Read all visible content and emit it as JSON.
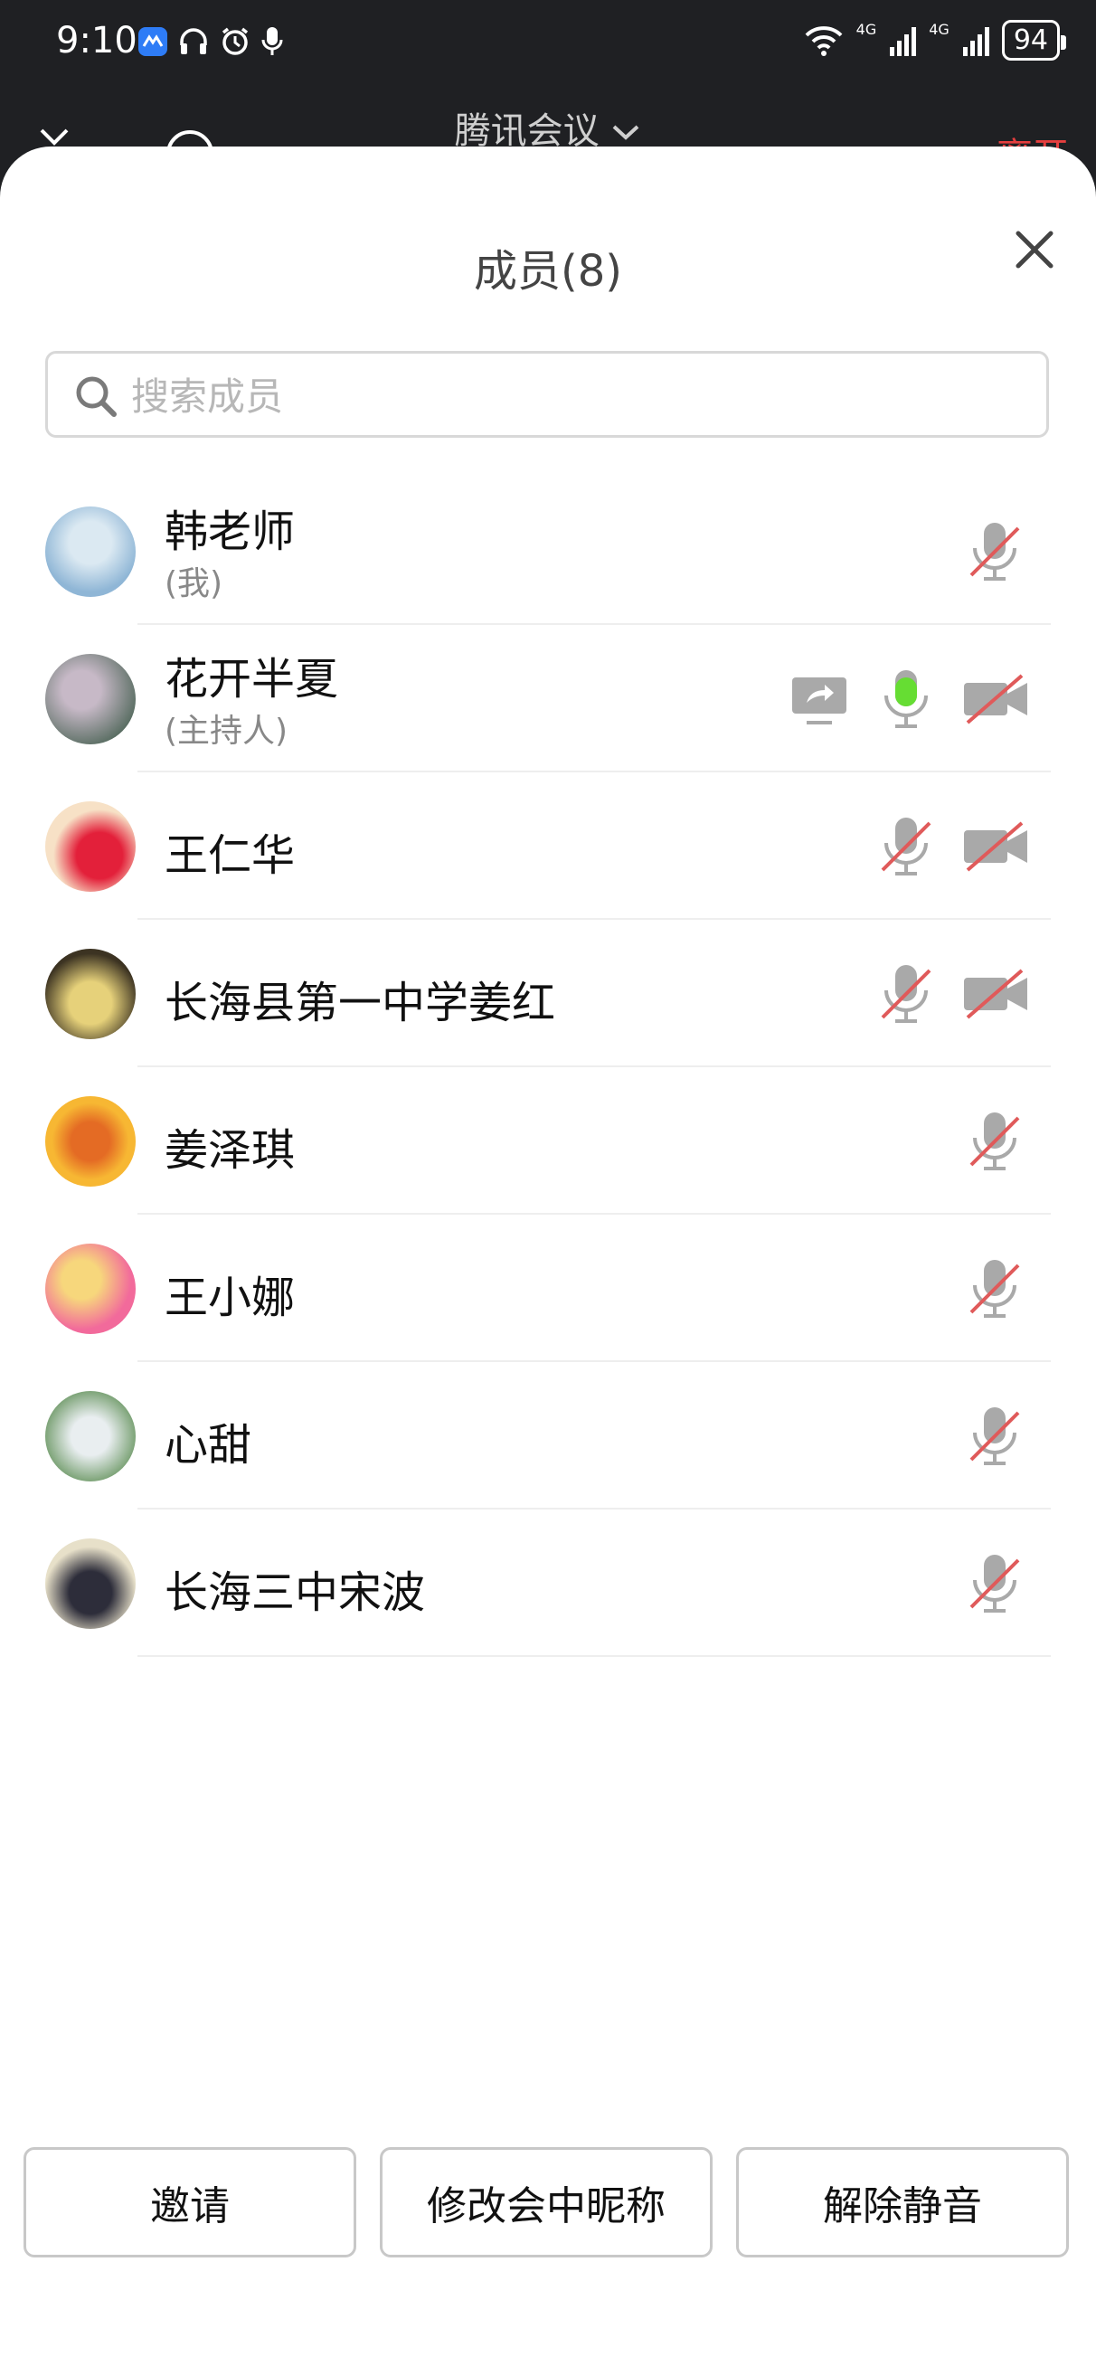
{
  "status_bar": {
    "time": "9:10",
    "battery": "94",
    "network_1": "4G",
    "network_2": "4G"
  },
  "background_header": {
    "app_title": "腾讯会议",
    "leave_label": "离开"
  },
  "panel": {
    "title": "成员(8)",
    "search": {
      "placeholder": "搜索成员",
      "value": ""
    }
  },
  "members": [
    {
      "name": "韩老师",
      "role": "(我)",
      "avatar_colors": [
        "#8fb6d6",
        "#dbe9f2"
      ]
    },
    {
      "name": "花开半夏",
      "role": "(主持人)",
      "avatar_colors": [
        "#5a6e63",
        "#c7b9c7"
      ]
    },
    {
      "name": "王仁华",
      "role": "",
      "avatar_colors": [
        "#f7e1c6",
        "#e3203a"
      ]
    },
    {
      "name": "长海县第一中学姜红",
      "role": "",
      "avatar_colors": [
        "#3c3322",
        "#e6d17a"
      ]
    },
    {
      "name": "姜泽琪",
      "role": "",
      "avatar_colors": [
        "#f7b733",
        "#e46b24"
      ]
    },
    {
      "name": "王小娜",
      "role": "",
      "avatar_colors": [
        "#f26a9b",
        "#f7d77c"
      ]
    },
    {
      "name": "心甜",
      "role": "",
      "avatar_colors": [
        "#7fa57a",
        "#e9eef0"
      ]
    },
    {
      "name": "长海三中宋波",
      "role": "",
      "avatar_colors": [
        "#e7e0c9",
        "#2d2d3a"
      ]
    }
  ],
  "buttons": {
    "invite": "邀请",
    "rename": "修改会中昵称",
    "unmute": "解除静音"
  },
  "colors": {
    "muted_slash": "#e05a5a",
    "active_mic": "#66dd33",
    "icon_gray": "#9c9c9c"
  }
}
